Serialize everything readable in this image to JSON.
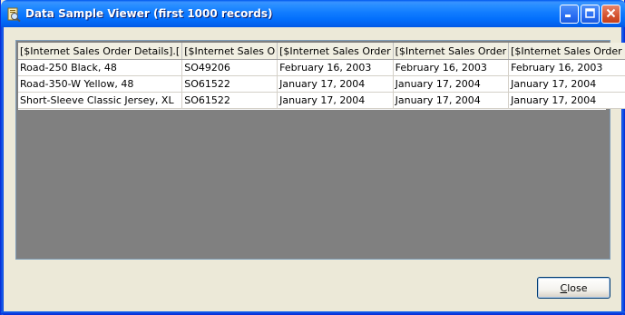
{
  "window": {
    "title": "Data Sample Viewer (first 1000 records)",
    "controls": {
      "minimize_icon": "minimize-icon",
      "maximize_icon": "maximize-icon",
      "close_icon": "close-icon"
    }
  },
  "grid": {
    "columns": [
      "[$Internet Sales Order Details].[",
      "[$Internet Sales O",
      "[$Internet Sales Order",
      "[$Internet Sales Order",
      "[$Internet Sales Order D"
    ],
    "rows": [
      [
        "Road-250 Black, 48",
        "SO49206",
        "February 16, 2003",
        "February 16, 2003",
        "February 16, 2003"
      ],
      [
        "Road-350-W Yellow, 48",
        "SO61522",
        "January 17, 2004",
        "January 17, 2004",
        "January 17, 2004"
      ],
      [
        "Short-Sleeve Classic Jersey, XL",
        "SO61522",
        "January 17, 2004",
        "January 17, 2004",
        "January 17, 2004"
      ]
    ]
  },
  "footer": {
    "close_label_mnemonic": "C",
    "close_label_rest": "lose"
  },
  "colors": {
    "titlebar": "#0058ee",
    "dialog_bg": "#ece9d8",
    "grid_empty_bg": "#808080"
  }
}
